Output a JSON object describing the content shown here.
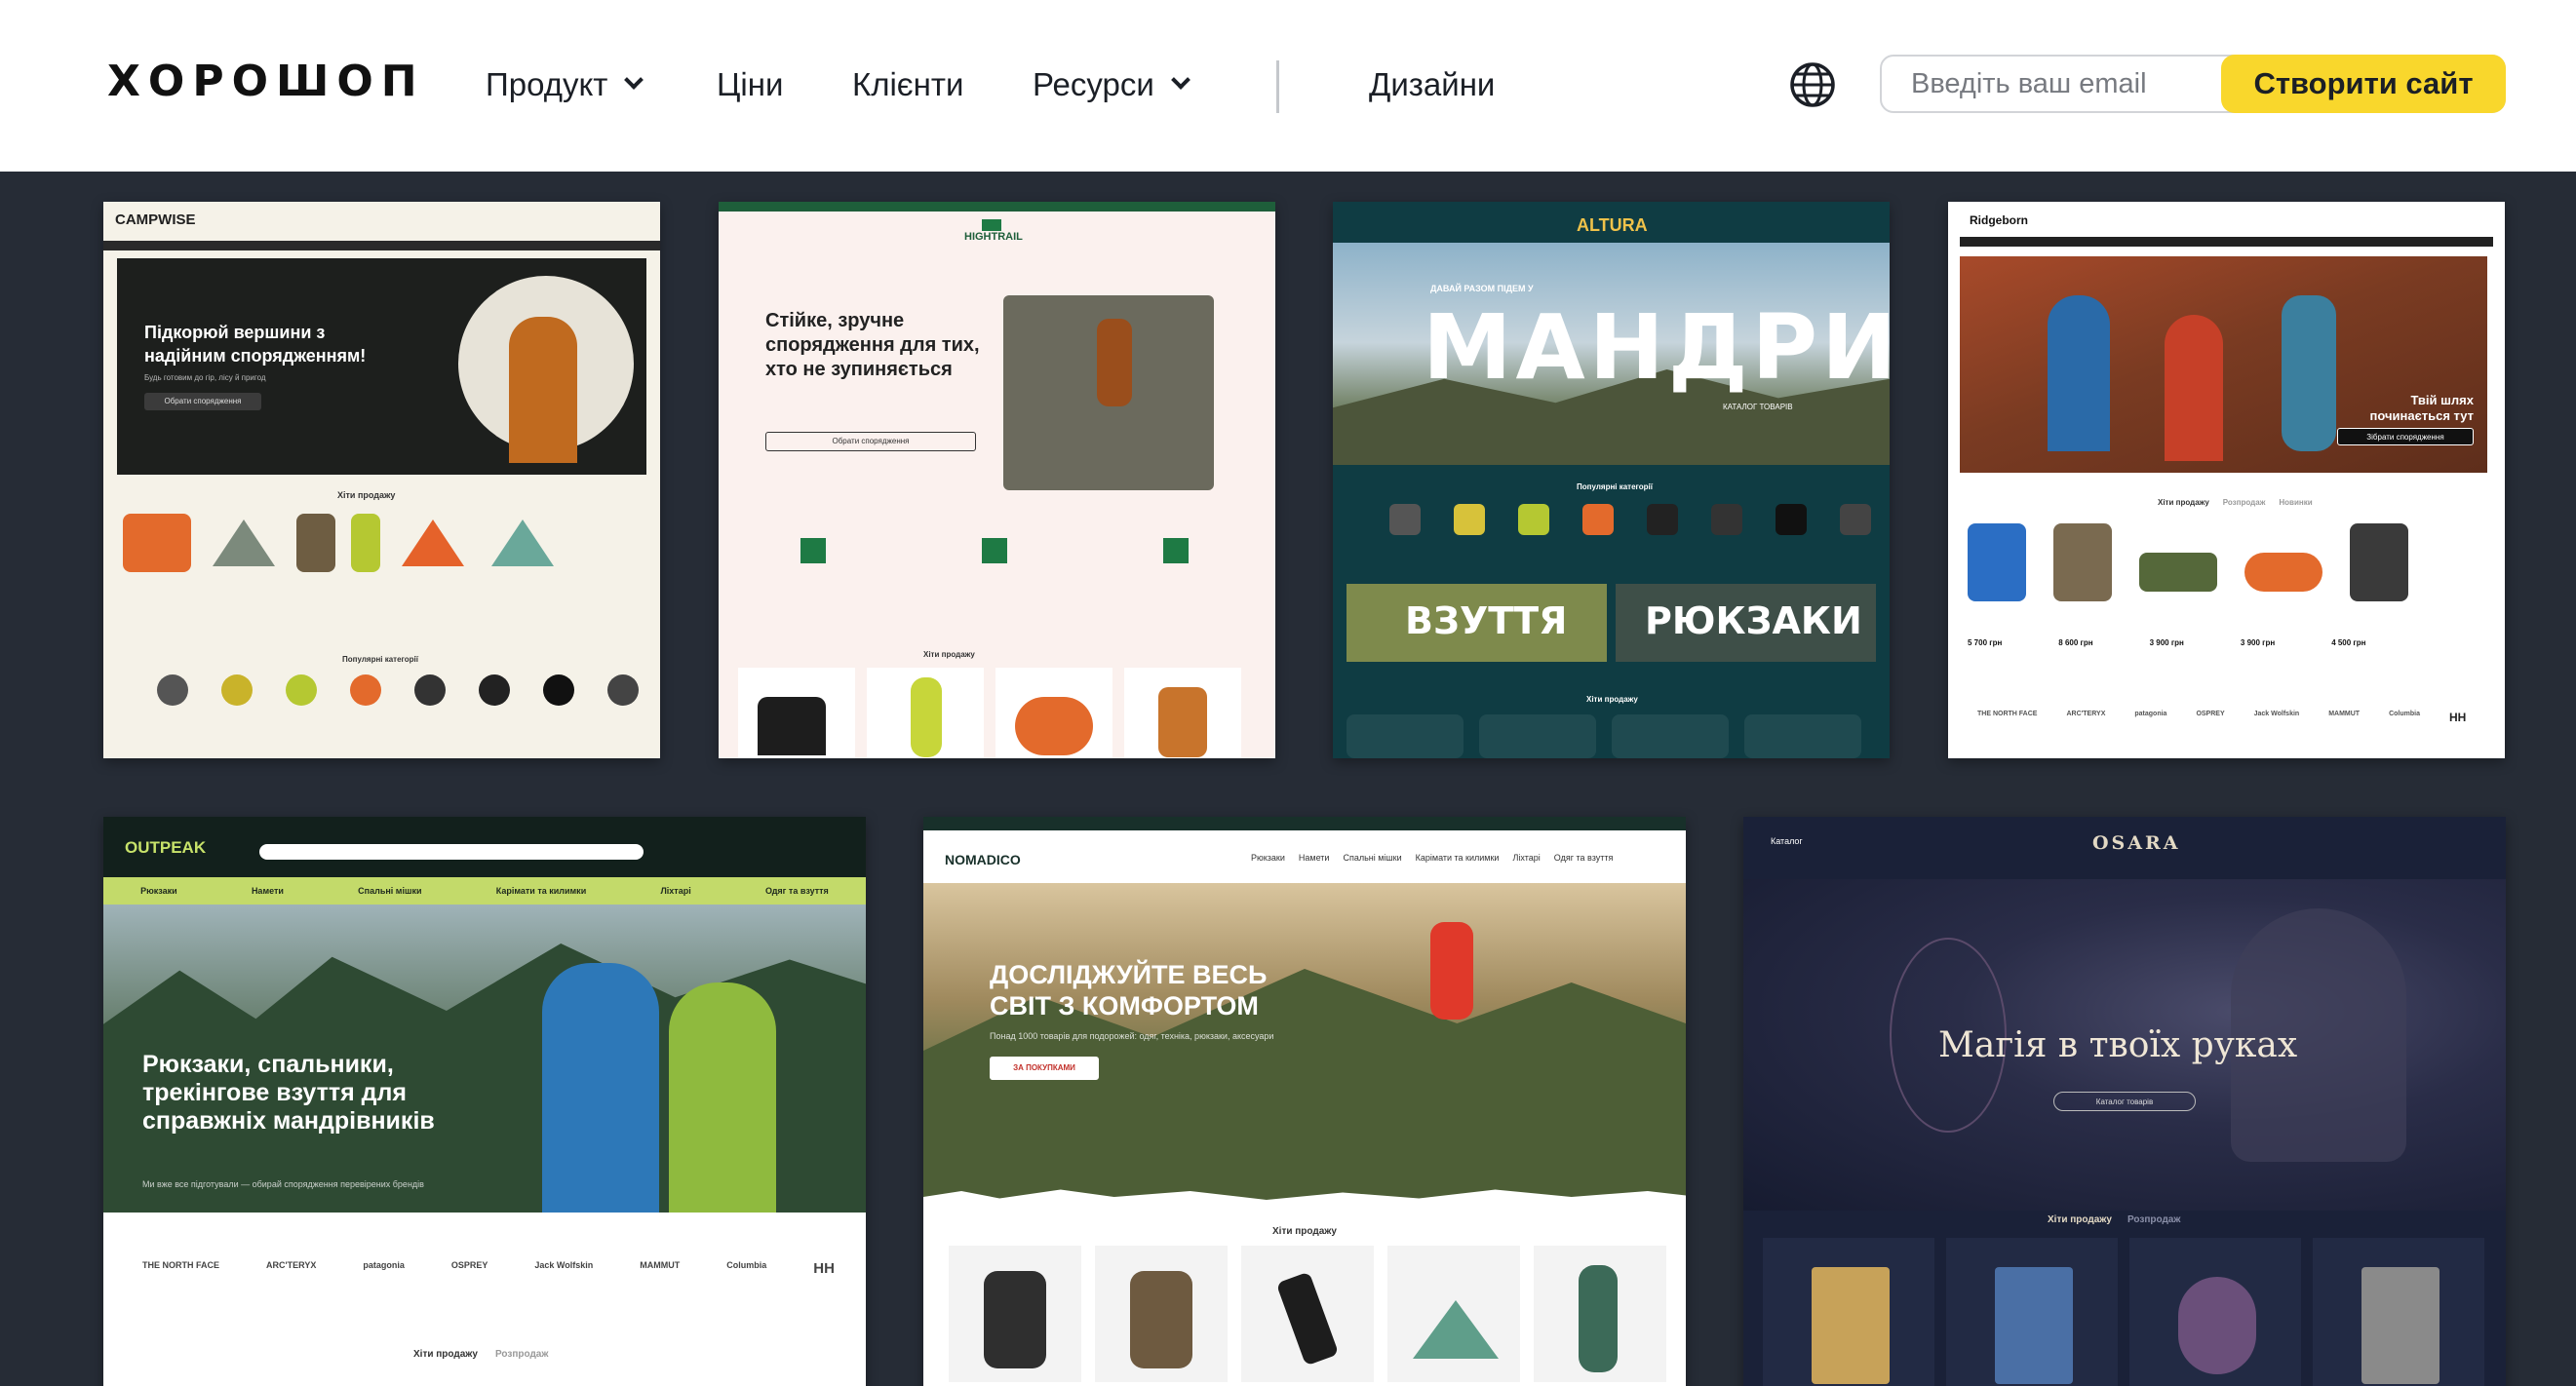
{
  "header": {
    "logo": "ХОРОШОП",
    "nav": {
      "product": "Продукт",
      "prices": "Ціни",
      "clients": "Клієнти",
      "resources": "Ресурси",
      "designs": "Дизайни"
    },
    "email_placeholder": "Введіть ваш email",
    "cta_label": "Створити сайт",
    "icons": {
      "language": "globe-icon",
      "dropdown": "chevron-down-icon"
    }
  },
  "colors": {
    "page_bg": "#262c36",
    "cta": "#f9d72c",
    "header_bg": "#ffffff"
  },
  "templates": [
    {
      "brand": "CAMPWISE",
      "hero": "Підкорюй вершини з\nнадійним спорядженням!",
      "subtitle": "Будь готовим до гір, лісу й пригод",
      "button": "Обрати спорядження",
      "section": "Хіти продажу",
      "section2": "Популярні категорії"
    },
    {
      "brand": "HIGHTRAIL",
      "hero": "Стійке, зручне\nспорядження для тих,\nхто не зупиняється",
      "button": "Обрати спорядження",
      "section": "Хіти продажу"
    },
    {
      "brand": "ALTURA",
      "kicker": "ДАВАЙ РАЗОМ ПІДЕМ У",
      "hero": "МАНДРИ",
      "link": "КАТАЛОГ ТОВАРІВ",
      "section": "Популярні категорії",
      "tile1": "ВЗУТТЯ",
      "tile2": "РЮКЗАКИ",
      "section2": "Хіти продажу"
    },
    {
      "brand": "Ridgeborn",
      "hero": "Твій шлях\nпочинається тут",
      "button": "Зібрати спорядження",
      "section": "Хіти продажу",
      "section_b": "Розпродаж",
      "section_c": "Новинки",
      "prices": [
        "5 700 грн",
        "8 600 грн",
        "3 900 грн",
        "3 900 грн",
        "4 500 грн"
      ],
      "brands": [
        "THE NORTH FACE",
        "ARC'TERYX",
        "patagonia",
        "OSPREY",
        "Jack Wolfskin",
        "MAMMUT",
        "Columbia",
        "HH"
      ]
    },
    {
      "brand": "OUTPEAK",
      "menu": [
        "Рюкзаки",
        "Намети",
        "Спальні мішки",
        "Карімати та килимки",
        "Ліхтарі",
        "Одяг та взуття"
      ],
      "hero": "Рюкзаки, спальники,\nтрекінгове взуття для\nсправжніх мандрівників",
      "subtitle": "Ми вже все підготували — обирай спорядження перевірених брендів",
      "brands": [
        "THE NORTH FACE",
        "ARC'TERYX",
        "patagonia",
        "OSPREY",
        "Jack Wolfskin",
        "MAMMUT",
        "Columbia",
        "HH"
      ],
      "section": "Хіти продажу",
      "section_b": "Розпродаж"
    },
    {
      "brand": "NOMADICO",
      "menu": [
        "Рюкзаки",
        "Намети",
        "Спальні мішки",
        "Карімати та килимки",
        "Ліхтарі",
        "Одяг та взуття"
      ],
      "hero": "ДОСЛІДЖУЙТЕ ВЕСЬ\nСВІТ З КОМФОРТОМ",
      "subtitle": "Понад 1000 товарів для подорожей: одяг, техніка, рюкзаки, аксесуари",
      "button": "ЗА ПОКУПКАМИ",
      "section": "Хіти продажу"
    },
    {
      "brand": "OSARA",
      "catalog": "Каталог",
      "hero": "Магія в твоїх руках",
      "button": "Каталог товарів",
      "section": "Хіти продажу",
      "section_b": "Розпродаж"
    }
  ]
}
